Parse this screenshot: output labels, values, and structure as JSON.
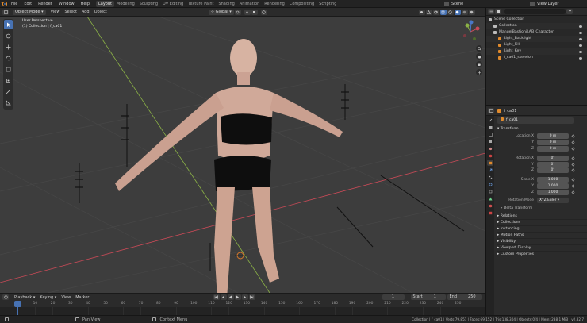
{
  "menu": [
    "File",
    "Edit",
    "Render",
    "Window",
    "Help"
  ],
  "workspaces": [
    "Layout",
    "Modeling",
    "Sculpting",
    "UV Editing",
    "Texture Paint",
    "Shading",
    "Animation",
    "Rendering",
    "Compositing",
    "Scripting"
  ],
  "active_workspace": "Layout",
  "scene_name": "Scene",
  "view_layer": "View Layer",
  "viewport": {
    "mode": "Object Mode",
    "menus": [
      "View",
      "Select",
      "Add",
      "Object"
    ],
    "orientation": "Global",
    "perspective": "User Perspective",
    "collection_info": "(1) Collection | f_ca01"
  },
  "timeline": {
    "menus": [
      "Playback",
      "Keying",
      "View",
      "Marker"
    ],
    "current_frame": "1",
    "start_label": "Start",
    "start": "1",
    "end_label": "End",
    "end": "250",
    "ticks": [
      "1",
      "10",
      "20",
      "30",
      "40",
      "50",
      "60",
      "70",
      "80",
      "90",
      "100",
      "110",
      "120",
      "130",
      "140",
      "150",
      "160",
      "170",
      "180",
      "190",
      "200",
      "210",
      "220",
      "230",
      "240",
      "250"
    ]
  },
  "statusbar": {
    "select": "",
    "pan": "Pan View",
    "context": "Context Menu",
    "info": "Collection | f_ca01 | Verts:79,851 | Faces:69,152 | Tris:138,304 | Objects:0/4 | Mem: 238.1 MiB | v2.82.7"
  },
  "outliner": {
    "items": [
      {
        "label": "Scene Collection",
        "indent": 0
      },
      {
        "label": "Collection",
        "indent": 1
      },
      {
        "label": "ManuelBastioniLAB_Character",
        "indent": 1
      },
      {
        "label": "Light_Backlight",
        "indent": 2
      },
      {
        "label": "Light_Fill",
        "indent": 2
      },
      {
        "label": "Light_Key",
        "indent": 2
      },
      {
        "label": "f_ca01_skeleton",
        "indent": 2
      }
    ]
  },
  "properties": {
    "object_name": "f_ca01",
    "object_field": "f_ca01",
    "transform_title": "Transform",
    "fields": [
      {
        "label": "Location X",
        "value": "0 m"
      },
      {
        "label": "Y",
        "value": "0 m"
      },
      {
        "label": "Z",
        "value": "0 m"
      },
      {
        "label": "Rotation X",
        "value": "0°"
      },
      {
        "label": "Y",
        "value": "0°"
      },
      {
        "label": "Z",
        "value": "0°"
      },
      {
        "label": "Scale X",
        "value": "1.000"
      },
      {
        "label": "Y",
        "value": "1.000"
      },
      {
        "label": "Z",
        "value": "1.000"
      }
    ],
    "rotation_mode_label": "Rotation Mode",
    "rotation_mode_value": "XYZ Euler",
    "delta_transform": "Delta Transform",
    "sections": [
      "Relations",
      "Collections",
      "Instancing",
      "Motion Paths",
      "Visibility",
      "Viewport Display",
      "Custom Properties"
    ]
  },
  "colors": {
    "accent": "#4772b3",
    "x_axis": "#c84a57",
    "y_axis": "#8bb246",
    "grid": "#474747"
  }
}
